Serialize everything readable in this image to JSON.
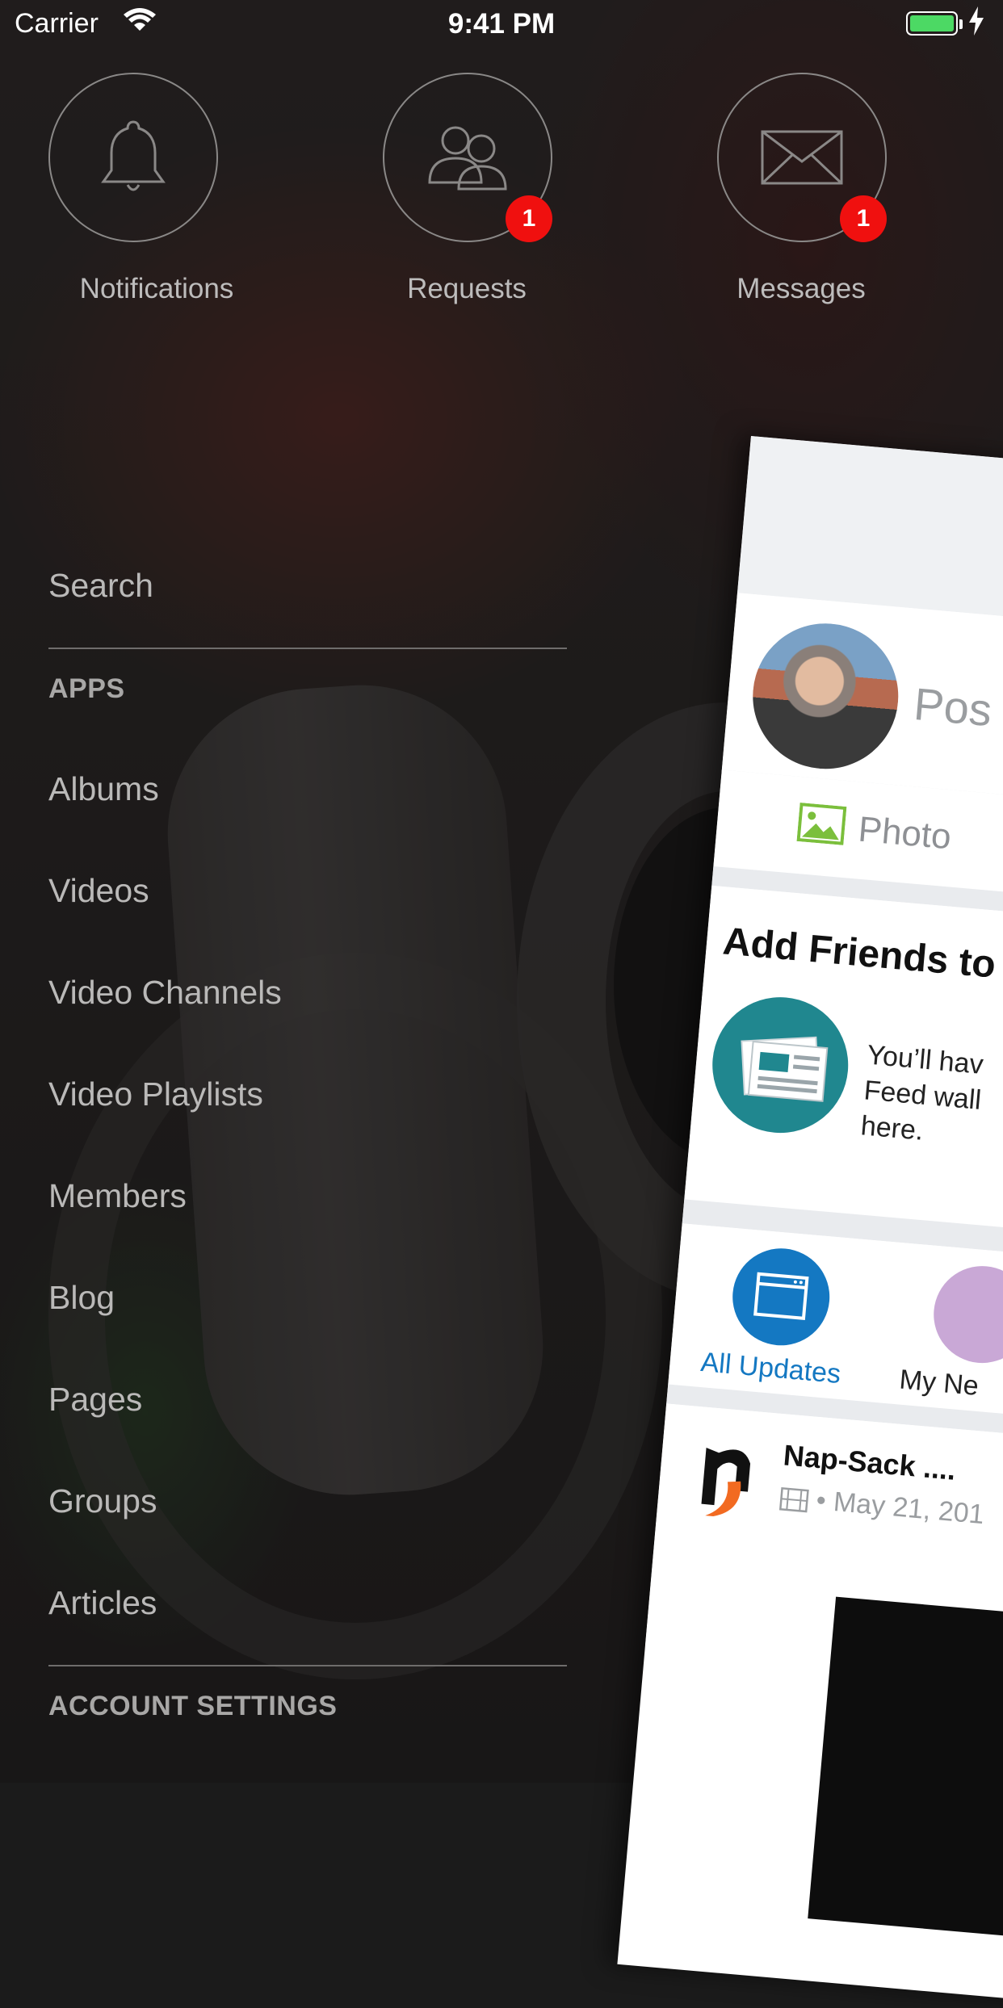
{
  "status_bar": {
    "carrier": "Carrier",
    "time": "9:41 PM",
    "battery_color": "#4cd964"
  },
  "quick_actions": [
    {
      "label": "Notifications",
      "icon": "bell-icon",
      "badge": null
    },
    {
      "label": "Requests",
      "icon": "people-icon",
      "badge": "1"
    },
    {
      "label": "Messages",
      "icon": "envelope-icon",
      "badge": "1"
    }
  ],
  "menu": {
    "search": "Search",
    "apps_header": "APPS",
    "items": [
      "Albums",
      "Videos",
      "Video Channels",
      "Video Playlists",
      "Members",
      "Blog",
      "Pages",
      "Groups",
      "Articles"
    ],
    "account_header": "ACCOUNT SETTINGS"
  },
  "main_screen": {
    "compose_placeholder": "Pos",
    "photo_label": "Photo",
    "add_friends_title": "Add Friends to",
    "add_friends_text": [
      "You’ll hav",
      "Feed wall",
      "here."
    ],
    "filters": [
      {
        "label": "All Updates",
        "active": true
      },
      {
        "label": "My Ne",
        "active": false
      }
    ],
    "feed_item": {
      "name": "Nap-Sack ....",
      "meta": "• May 21, 201"
    }
  },
  "colors": {
    "badge": "#f0100f",
    "accent_blue": "#1478c2",
    "menu_text": "#bab9b8"
  }
}
